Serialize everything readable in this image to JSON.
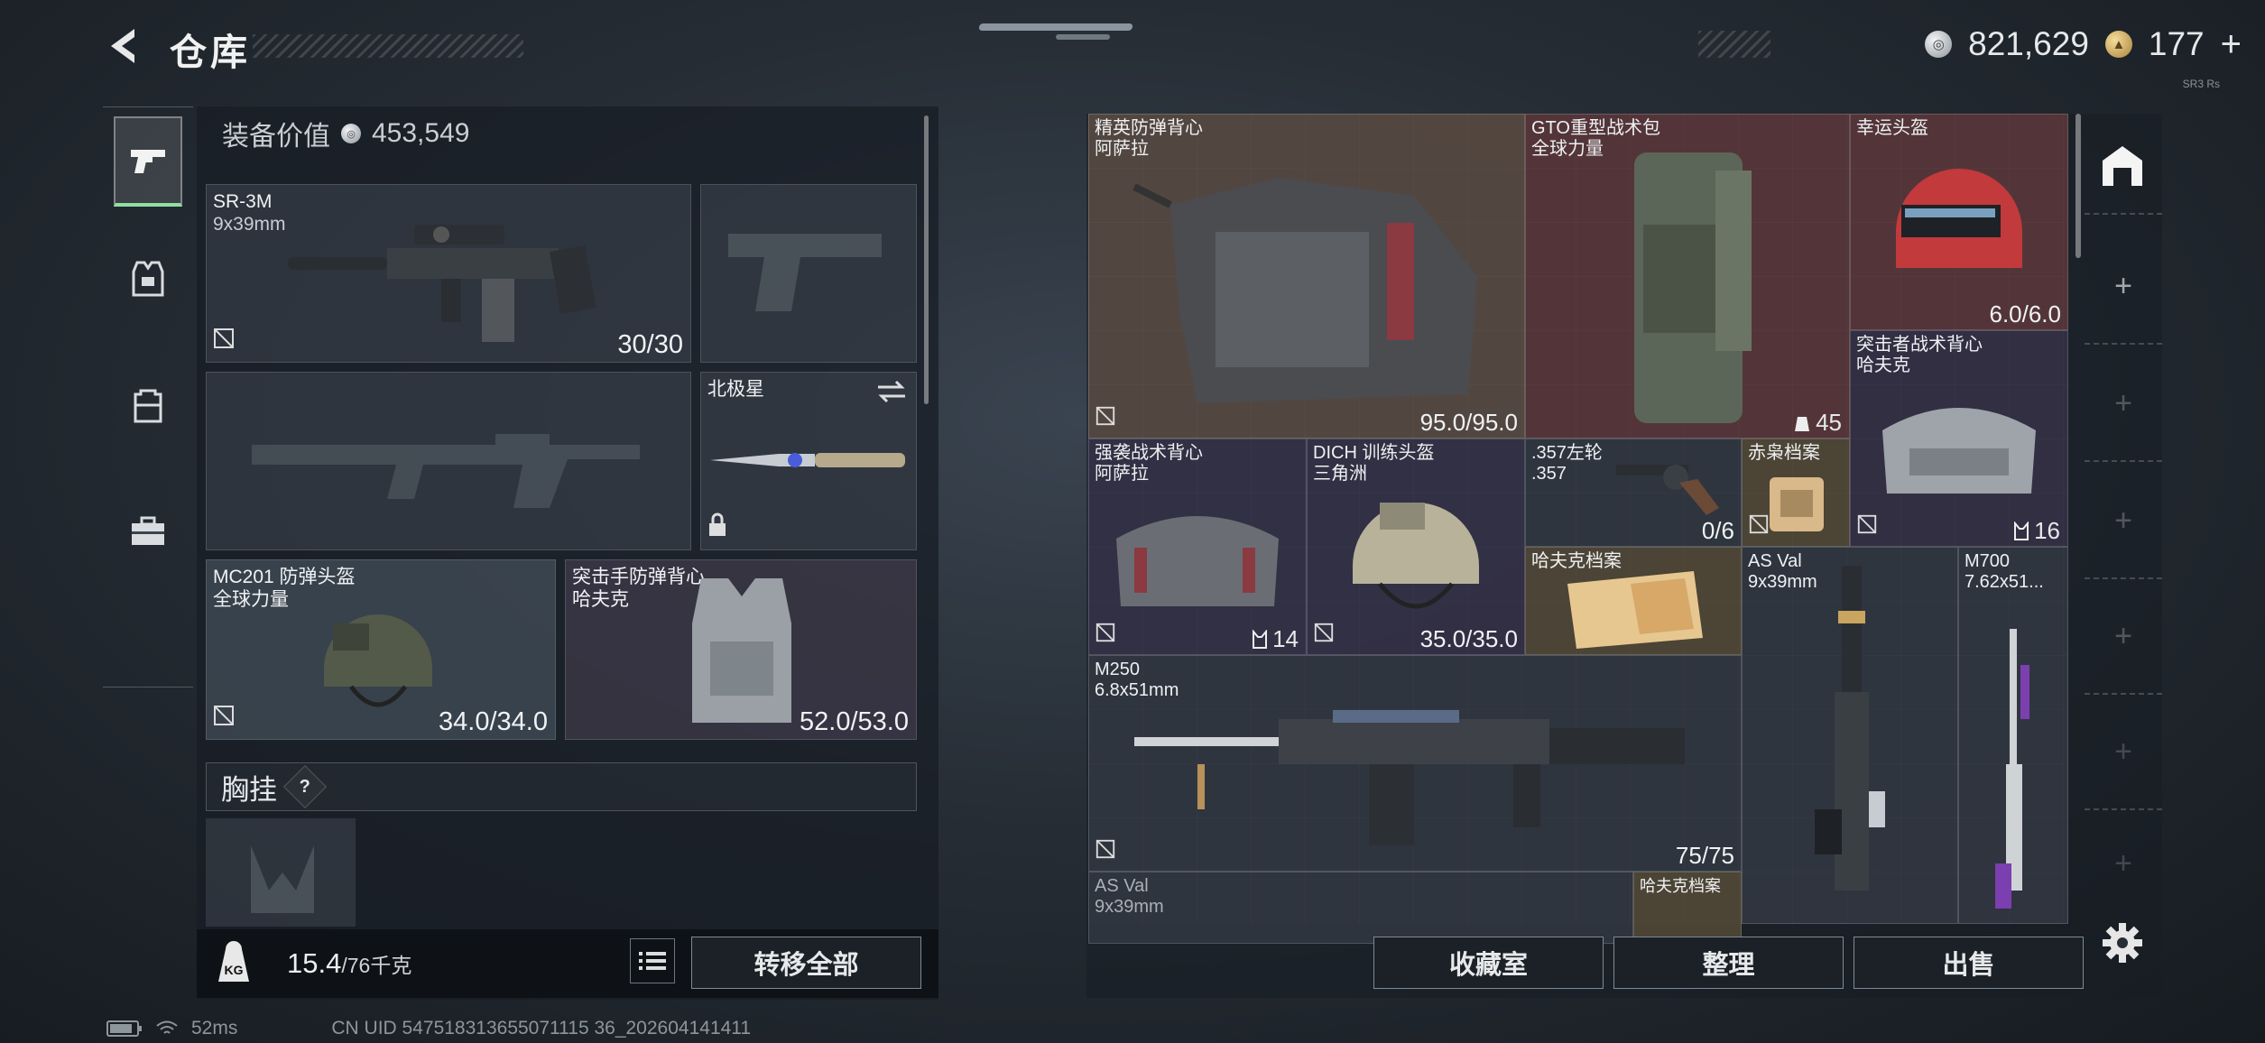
{
  "header": {
    "title": "仓库",
    "currency_silver": "821,629",
    "currency_gold": "177",
    "plus": "+",
    "version": "SR3 Rs"
  },
  "left": {
    "equip_value_label": "装备价值",
    "equip_value": "453,549",
    "slots": {
      "primary": {
        "name": "SR-3M",
        "caliber": "9x39mm",
        "ammo": "30/30"
      },
      "knife": {
        "name": "北极星"
      },
      "helmet": {
        "name": "MC201 防弹头盔",
        "maker": "全球力量",
        "durability": "34.0/34.0"
      },
      "armor": {
        "name": "突击手防弹背心",
        "maker": "哈夫克",
        "durability": "52.0/53.0"
      }
    },
    "chest_rig_label": "胸挂",
    "help": "?",
    "weight": "15.4",
    "weight_cap": "/76千克",
    "transfer_all": "转移全部"
  },
  "grid": {
    "items": [
      {
        "name": "精英防弹背心",
        "maker": "阿萨拉",
        "durability": "95.0/95.0"
      },
      {
        "name": "GTO重型战术包",
        "maker": "全球力量",
        "count": "45"
      },
      {
        "name": "幸运头盔",
        "durability": "6.0/6.0"
      },
      {
        "name": "突击者战术背心",
        "maker": "哈夫克",
        "count": "16"
      },
      {
        "name": "强袭战术背心",
        "maker": "阿萨拉",
        "count": "14"
      },
      {
        "name": "DICH 训练头盔",
        "maker": "三角洲",
        "durability": "35.0/35.0"
      },
      {
        "name": ".357左轮",
        "caliber": ".357",
        "ammo": "0/6"
      },
      {
        "name": "赤枭档案"
      },
      {
        "name": "哈夫克档案"
      },
      {
        "name": "AS Val",
        "caliber": "9x39mm"
      },
      {
        "name": "M700",
        "caliber": "7.62x51..."
      },
      {
        "name": "M250",
        "caliber": "6.8x51mm",
        "ammo": "75/75"
      },
      {
        "name": "AS Val",
        "caliber": "9x39mm"
      },
      {
        "name": "哈夫克档案"
      }
    ]
  },
  "footer_right": {
    "collection": "收藏室",
    "sort": "整理",
    "sell": "出售"
  },
  "status": {
    "ping": "52ms",
    "uid": "CN UID 547518313655071115 36_202604141411"
  }
}
